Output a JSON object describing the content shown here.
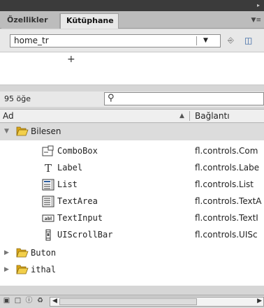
{
  "tabs": [
    {
      "label": "Özellikler",
      "active": false
    },
    {
      "label": "Kütüphane",
      "active": true
    }
  ],
  "library_selector": {
    "value": "home_tr"
  },
  "item_count": "95 öğe",
  "search": {
    "placeholder": ""
  },
  "columns": {
    "name": "Ad",
    "linkage": "Bağlantı"
  },
  "tree": [
    {
      "type": "folder",
      "label": "Bilesen",
      "expanded": true
    },
    {
      "type": "item",
      "label": "ComboBox",
      "linkage": "fl.controls.Com",
      "icon": "combobox-icon"
    },
    {
      "type": "item",
      "label": "Label",
      "linkage": "fl.controls.Labe",
      "icon": "text-icon"
    },
    {
      "type": "item",
      "label": "List",
      "linkage": "fl.controls.List",
      "icon": "list-icon"
    },
    {
      "type": "item",
      "label": "TextArea",
      "linkage": "fl.controls.TextA",
      "icon": "textarea-icon"
    },
    {
      "type": "item",
      "label": "TextInput",
      "linkage": "fl.controls.TextI",
      "icon": "textinput-icon"
    },
    {
      "type": "item",
      "label": "UIScrollBar",
      "linkage": "fl.controls.UISc",
      "icon": "scrollbar-icon"
    },
    {
      "type": "folder",
      "label": "Buton",
      "expanded": false
    },
    {
      "type": "folder",
      "label": "ithal",
      "expanded": false
    }
  ],
  "colors": {
    "folder": "#e8c229",
    "selected_folder_row": "#dcdcdc",
    "panel_bg": "#e8e8e8"
  }
}
